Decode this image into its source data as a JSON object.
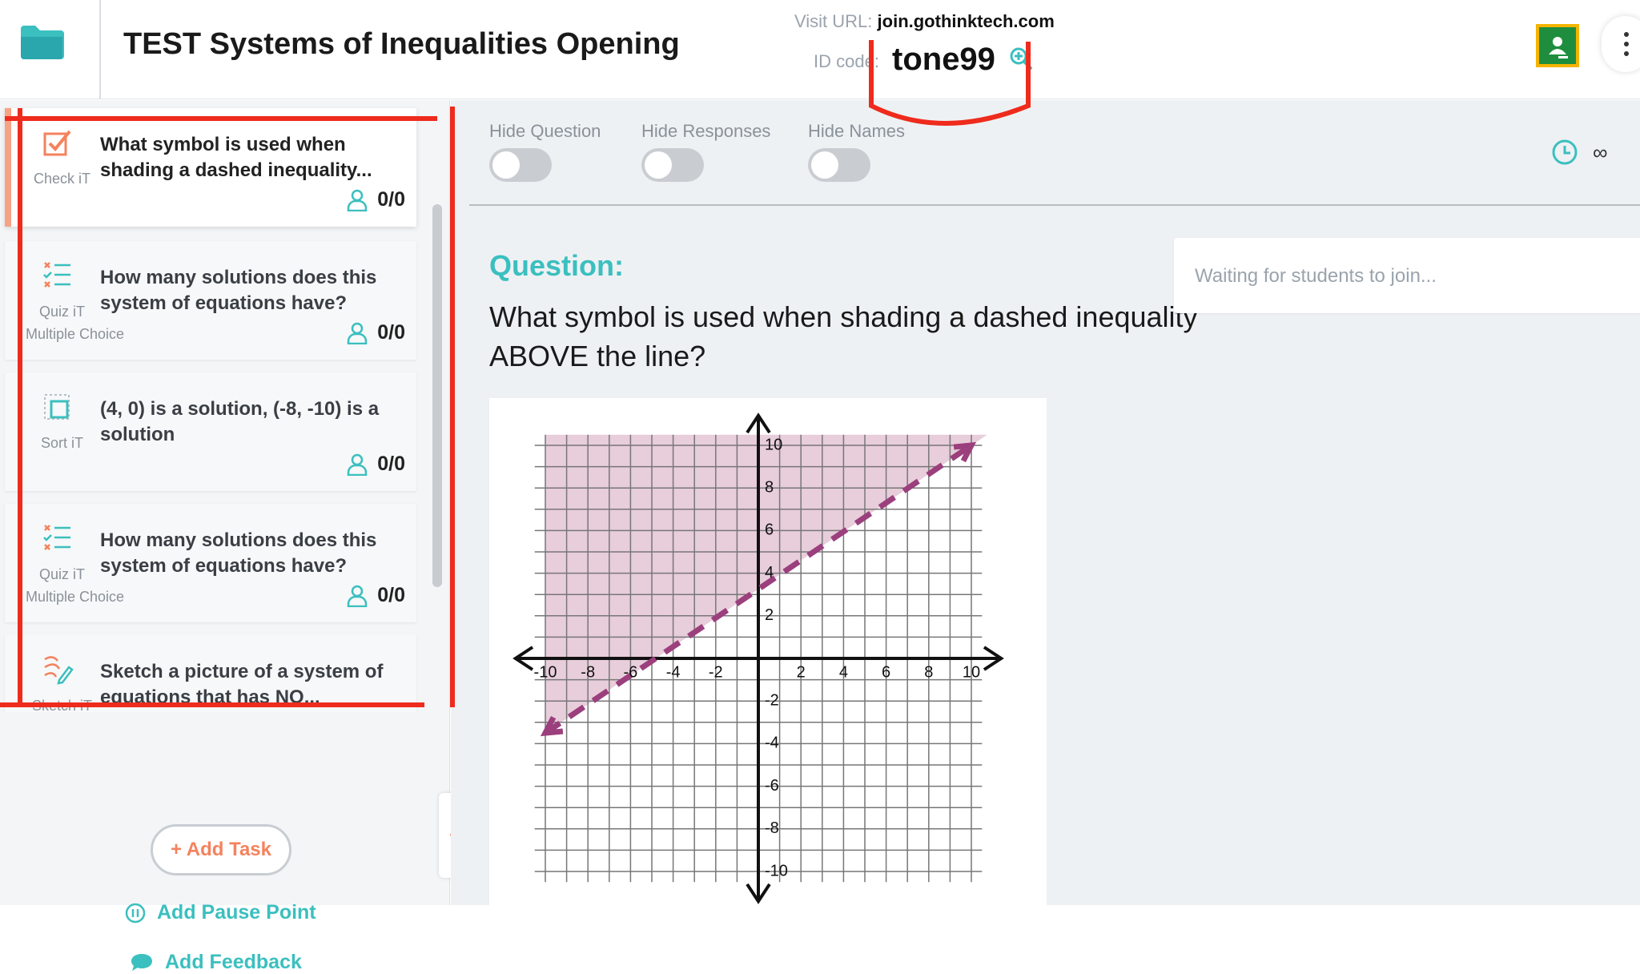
{
  "header": {
    "title": "TEST Systems of Inequalities Opening",
    "visit_url_label": "Visit URL:",
    "visit_url": "join.gothinktech.com",
    "id_code_label": "ID code:",
    "id_code": "tone99"
  },
  "sidebar": {
    "tasks": [
      {
        "type_label": "Check iT",
        "question": "What symbol is used when shading a dashed inequality...",
        "subtype": "",
        "count": "0/0",
        "icon": "checkbox-icon"
      },
      {
        "type_label": "Quiz iT",
        "question": "How many solutions does this system of equations have?",
        "subtype": "Multiple Choice",
        "count": "0/0",
        "icon": "quiz-list-icon"
      },
      {
        "type_label": "Sort iT",
        "question": "(4, 0) is a solution, (-8, -10) is a solution",
        "subtype": "",
        "count": "0/0",
        "icon": "sort-icon"
      },
      {
        "type_label": "Quiz iT",
        "question": "How many solutions does this system of equations have?",
        "subtype": "Multiple Choice",
        "count": "0/0",
        "icon": "quiz-list-icon"
      },
      {
        "type_label": "Sketch iT",
        "question": "Sketch a picture of a system of equations that has NO...",
        "subtype": "",
        "count": "",
        "icon": "sketch-icon"
      }
    ],
    "add_task": "+ Add Task",
    "add_pause_point": "Add Pause Point",
    "add_feedback": "Add Feedback"
  },
  "main": {
    "toggles": [
      {
        "label": "Hide Question",
        "on": false
      },
      {
        "label": "Hide Responses",
        "on": false
      },
      {
        "label": "Hide Names",
        "on": false
      }
    ],
    "timer_value": "∞",
    "question_label": "Question:",
    "question_text": "What symbol is used when shading a dashed inequality ABOVE the line?",
    "waiting_text": "Waiting for students to join..."
  },
  "graph": {
    "x_ticks": [
      "-10",
      "-8",
      "-6",
      "-4",
      "-2",
      "2",
      "4",
      "6",
      "8",
      "10"
    ],
    "y_ticks": [
      "10",
      "8",
      "6",
      "4",
      "2",
      "-2",
      "-4",
      "-6",
      "-8",
      "-10"
    ],
    "line_from": [
      -10,
      -3.5
    ],
    "line_to": [
      10,
      10
    ],
    "shade": "above",
    "line_style": "dashed",
    "line_color": "#9b3f7d",
    "shade_color": "#e4c4d4"
  },
  "colors": {
    "accent_teal": "#3bbfbf",
    "accent_orange": "#f4825d",
    "annotation_red": "#ee2b1c"
  }
}
